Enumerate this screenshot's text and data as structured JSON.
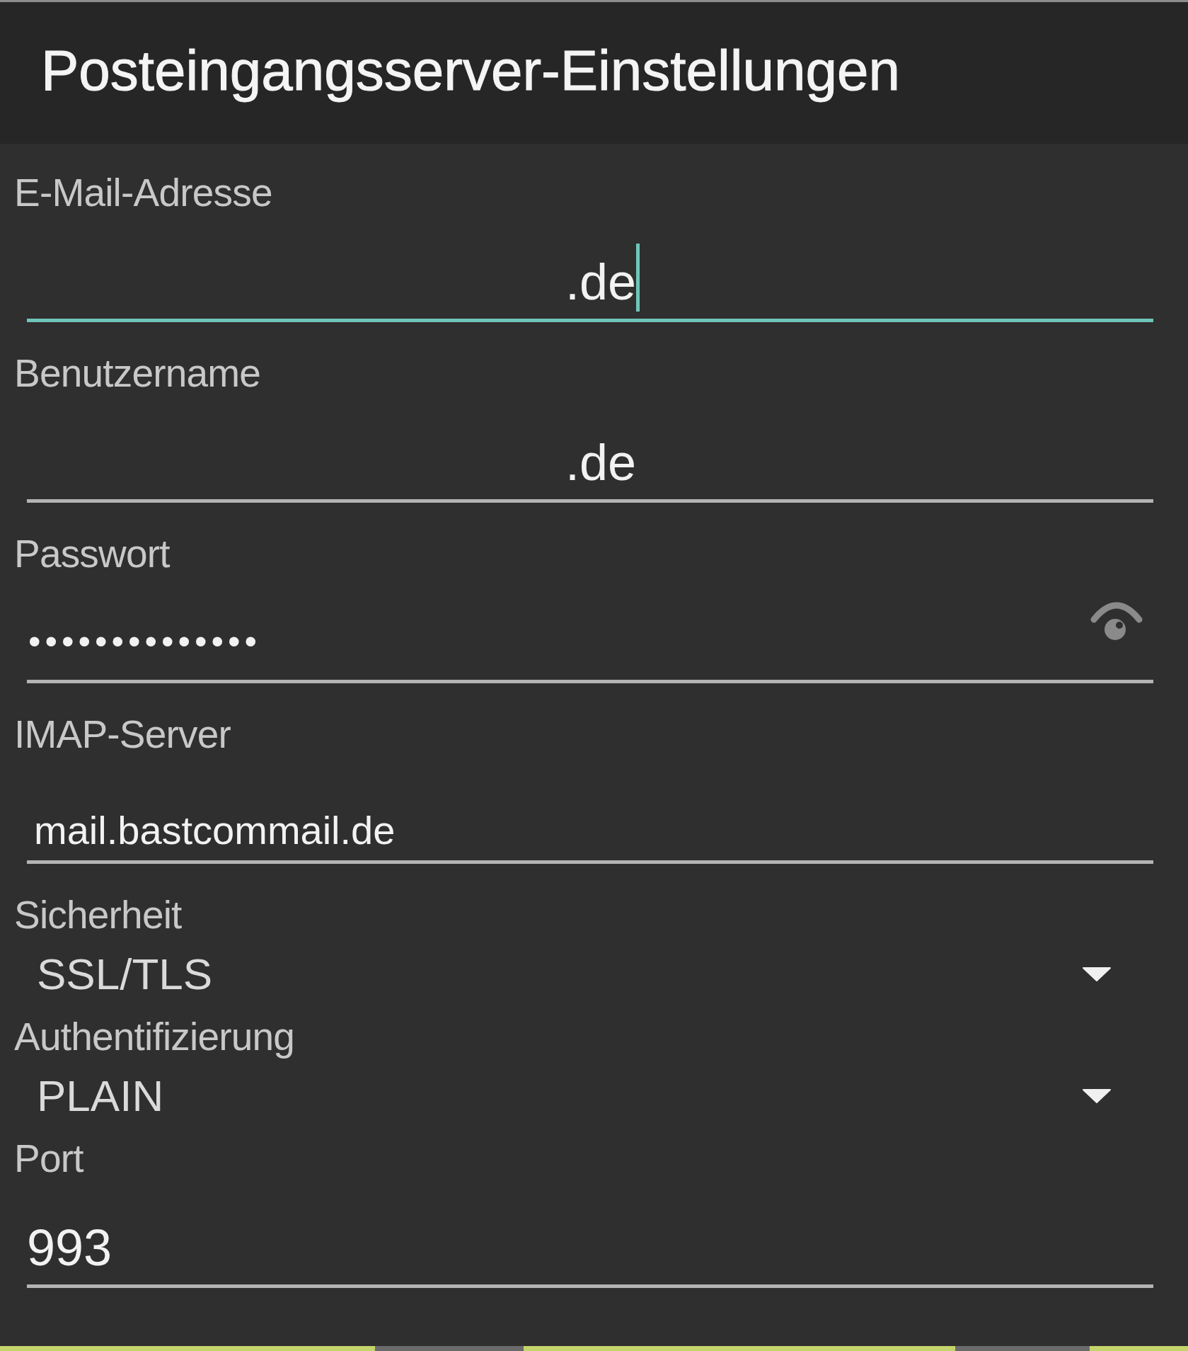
{
  "header": {
    "title": "Posteingangsserver-Einstellungen"
  },
  "fields": [
    {
      "kind": "text",
      "label": "E-Mail-Adresse",
      "value": ".de",
      "focused": true
    },
    {
      "kind": "text",
      "label": "Benutzername",
      "value": ".de",
      "focused": false
    },
    {
      "kind": "password",
      "label": "Passwort",
      "value": "••••••••••••••",
      "focused": false
    },
    {
      "kind": "text",
      "label": "IMAP-Server",
      "value": "mail.bastcommail.de",
      "focused": false
    },
    {
      "kind": "select",
      "label": "Sicherheit",
      "value": "SSL/TLS"
    },
    {
      "kind": "select",
      "label": "Authentifizierung",
      "value": "PLAIN"
    },
    {
      "kind": "text",
      "label": "Port",
      "value": "993",
      "focused": false
    }
  ]
}
